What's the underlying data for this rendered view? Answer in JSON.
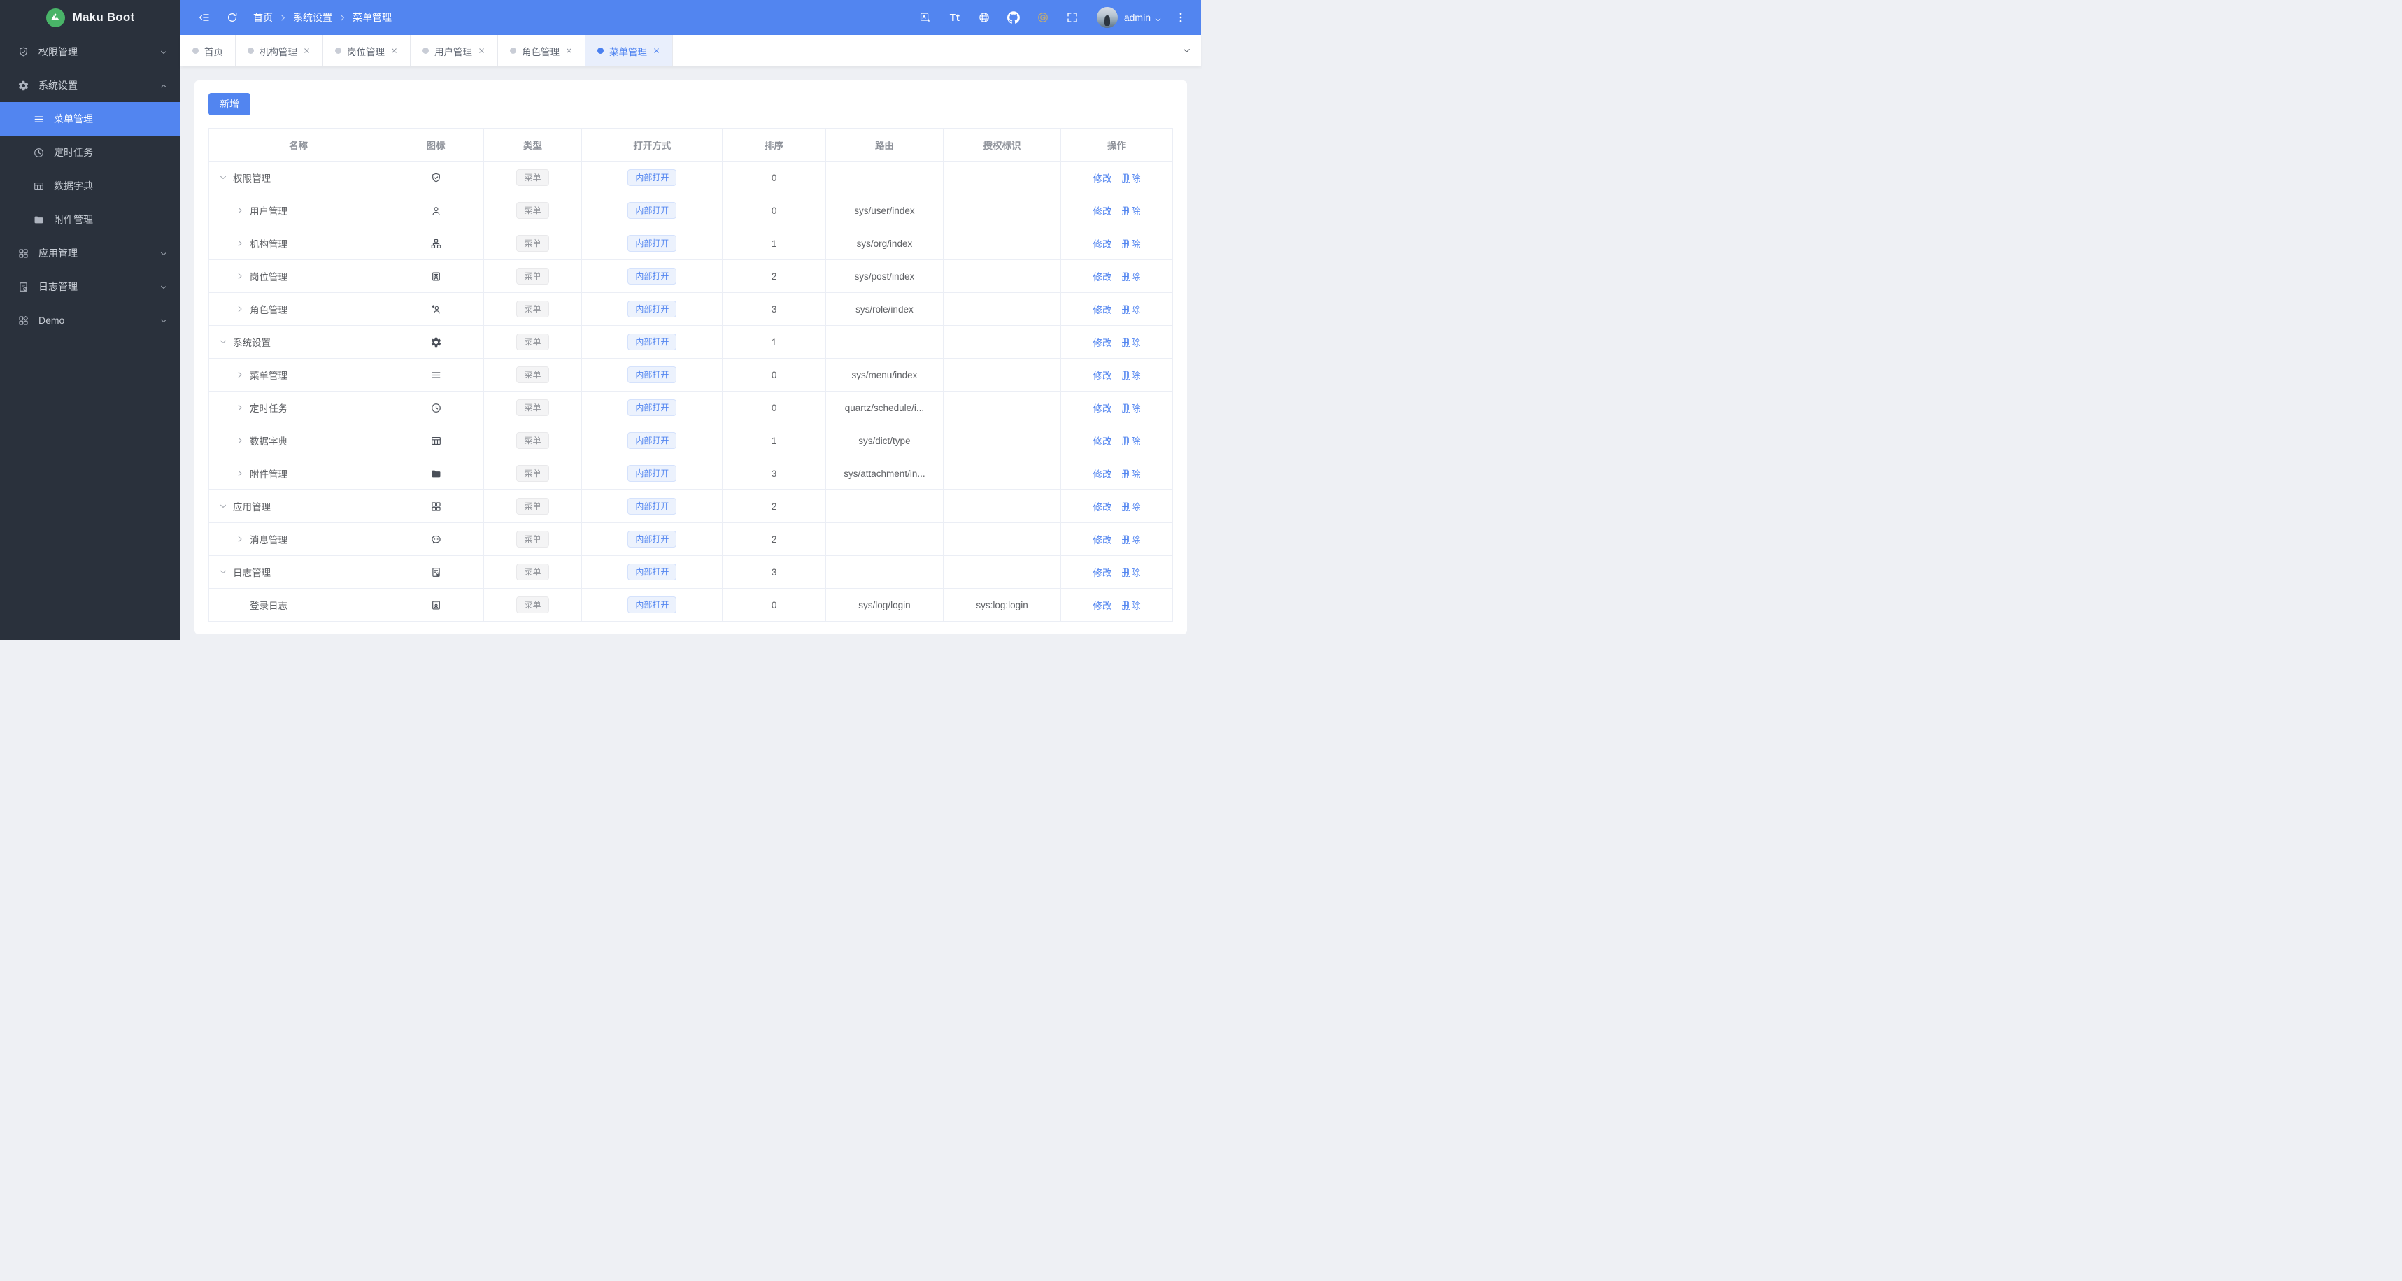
{
  "app": {
    "title": "Maku Boot"
  },
  "colors": {
    "primary": "#5285f0",
    "sidebar_bg": "#2a313c",
    "active_tab_bg": "#e9effc",
    "content_bg": "#eef0f4",
    "tag_gray_text": "#909399",
    "tag_blue_text": "#5285f0"
  },
  "header": {
    "breadcrumb": [
      "首页",
      "系统设置",
      "菜单管理"
    ],
    "font_size_label": "Tt",
    "user": "admin",
    "left_icons": [
      "collapse-icon",
      "refresh-icon"
    ],
    "right_icons": [
      "translate-icon",
      "font-size-icon",
      "globe-icon",
      "github-icon",
      "gitee-icon",
      "fullscreen-icon"
    ]
  },
  "tabs": [
    {
      "label": "首页",
      "closable": false,
      "active": false
    },
    {
      "label": "机构管理",
      "closable": true,
      "active": false
    },
    {
      "label": "岗位管理",
      "closable": true,
      "active": false
    },
    {
      "label": "用户管理",
      "closable": true,
      "active": false
    },
    {
      "label": "角色管理",
      "closable": true,
      "active": false
    },
    {
      "label": "菜单管理",
      "closable": true,
      "active": true
    }
  ],
  "sidebar": {
    "items": [
      {
        "label": "权限管理",
        "icon": "shield-check-icon",
        "chevron": "down"
      },
      {
        "label": "系统设置",
        "icon": "gear-icon",
        "chevron": "up",
        "expanded": true,
        "children": [
          {
            "label": "菜单管理",
            "icon": "menu-icon",
            "active": true
          },
          {
            "label": "定时任务",
            "icon": "clock-icon",
            "active": false
          },
          {
            "label": "数据字典",
            "icon": "table-icon",
            "active": false
          },
          {
            "label": "附件管理",
            "icon": "folder-icon",
            "active": false
          }
        ]
      },
      {
        "label": "应用管理",
        "icon": "grid-icon",
        "chevron": "down"
      },
      {
        "label": "日志管理",
        "icon": "doc-check-icon",
        "chevron": "down"
      },
      {
        "label": "Demo",
        "icon": "grid-alt-icon",
        "chevron": "down"
      }
    ]
  },
  "toolbar": {
    "add_label": "新增"
  },
  "table": {
    "columns": [
      "名称",
      "图标",
      "类型",
      "打开方式",
      "排序",
      "路由",
      "授权标识",
      "操作"
    ],
    "actions": [
      "修改",
      "删除"
    ],
    "rows": [
      {
        "name": "权限管理",
        "level": 0,
        "caret": "expanded",
        "icon": "shield-check-icon",
        "type": "菜单",
        "open": "内部打开",
        "sort": "0",
        "route": "",
        "perm": ""
      },
      {
        "name": "用户管理",
        "level": 1,
        "caret": "collapsed",
        "icon": "user-icon",
        "type": "菜单",
        "open": "内部打开",
        "sort": "0",
        "route": "sys/user/index",
        "perm": ""
      },
      {
        "name": "机构管理",
        "level": 1,
        "caret": "collapsed",
        "icon": "org-icon",
        "type": "菜单",
        "open": "内部打开",
        "sort": "1",
        "route": "sys/org/index",
        "perm": ""
      },
      {
        "name": "岗位管理",
        "level": 1,
        "caret": "collapsed",
        "icon": "id-badge-icon",
        "type": "菜单",
        "open": "内部打开",
        "sort": "2",
        "route": "sys/post/index",
        "perm": ""
      },
      {
        "name": "角色管理",
        "level": 1,
        "caret": "collapsed",
        "icon": "user-star-icon",
        "type": "菜单",
        "open": "内部打开",
        "sort": "3",
        "route": "sys/role/index",
        "perm": ""
      },
      {
        "name": "系统设置",
        "level": 0,
        "caret": "expanded",
        "icon": "gear-icon",
        "type": "菜单",
        "open": "内部打开",
        "sort": "1",
        "route": "",
        "perm": ""
      },
      {
        "name": "菜单管理",
        "level": 1,
        "caret": "collapsed",
        "icon": "menu-icon",
        "type": "菜单",
        "open": "内部打开",
        "sort": "0",
        "route": "sys/menu/index",
        "perm": ""
      },
      {
        "name": "定时任务",
        "level": 1,
        "caret": "collapsed",
        "icon": "clock-icon",
        "type": "菜单",
        "open": "内部打开",
        "sort": "0",
        "route": "quartz/schedule/i...",
        "perm": ""
      },
      {
        "name": "数据字典",
        "level": 1,
        "caret": "collapsed",
        "icon": "table-icon",
        "type": "菜单",
        "open": "内部打开",
        "sort": "1",
        "route": "sys/dict/type",
        "perm": ""
      },
      {
        "name": "附件管理",
        "level": 1,
        "caret": "collapsed",
        "icon": "folder-icon",
        "type": "菜单",
        "open": "内部打开",
        "sort": "3",
        "route": "sys/attachment/in...",
        "perm": ""
      },
      {
        "name": "应用管理",
        "level": 0,
        "caret": "expanded",
        "icon": "grid-icon",
        "type": "菜单",
        "open": "内部打开",
        "sort": "2",
        "route": "",
        "perm": ""
      },
      {
        "name": "消息管理",
        "level": 1,
        "caret": "collapsed",
        "icon": "chat-icon",
        "type": "菜单",
        "open": "内部打开",
        "sort": "2",
        "route": "",
        "perm": ""
      },
      {
        "name": "日志管理",
        "level": 0,
        "caret": "expanded",
        "icon": "doc-check-icon",
        "type": "菜单",
        "open": "内部打开",
        "sort": "3",
        "route": "",
        "perm": ""
      },
      {
        "name": "登录日志",
        "level": 1,
        "caret": "none",
        "icon": "id-badge-icon",
        "type": "菜单",
        "open": "内部打开",
        "sort": "0",
        "route": "sys/log/login",
        "perm": "sys:log:login"
      }
    ]
  }
}
